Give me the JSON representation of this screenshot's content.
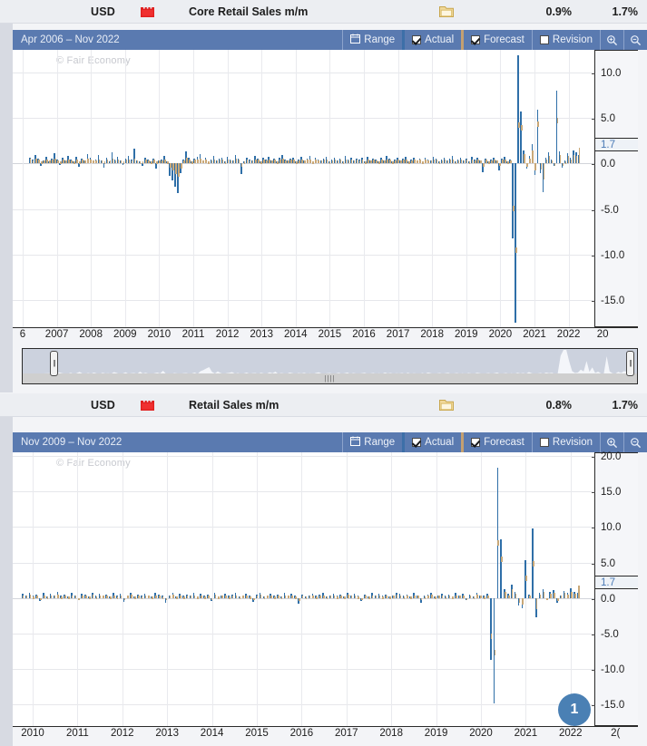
{
  "colors": {
    "actual": "#2f6fa8",
    "forecast": "#c9a878",
    "toolbar": "#5a7ab0",
    "impact_high": "#e02020",
    "badge": "#4a80b4",
    "marker_text": "#4a7ab5"
  },
  "panels": [
    {
      "event": {
        "currency": "USD",
        "impact_icon": "red-folder-icon",
        "title": "Core Retail Sales m/m",
        "detail_icon": "folder-icon",
        "actual": "0.9%",
        "forecast": "1.7%"
      },
      "toolbar": {
        "range_label": "Apr 2006 – Nov 2022",
        "range_button": "Range",
        "range_icon": "calendar-icon",
        "actual_label": "Actual",
        "actual_checked": true,
        "forecast_label": "Forecast",
        "forecast_checked": true,
        "revision_label": "Revision",
        "revision_checked": false,
        "zoom_in_icon": "zoom-in-icon",
        "zoom_out_icon": "zoom-out-icon"
      },
      "watermark": "© Fair Economy",
      "value_marker": "1.7",
      "chart_data": {
        "type": "bar",
        "title": "Core Retail Sales m/m",
        "xlabel": "",
        "ylabel": "%",
        "ylim": [
          -18.0,
          12.5
        ],
        "yticks": [
          "10.0",
          "5.0",
          "0.0",
          "-5.0",
          "-10.0",
          "-15.0"
        ],
        "ytick_values": [
          10.0,
          5.0,
          0.0,
          -5.0,
          -10.0,
          -15.0
        ],
        "grid": true,
        "legend_position": "toolbar",
        "xticks": [
          "6",
          "2007",
          "2008",
          "2009",
          "2010",
          "2011",
          "2012",
          "2013",
          "2014",
          "2015",
          "2016",
          "2017",
          "2018",
          "2019",
          "2020",
          "2021",
          "2022",
          "20"
        ],
        "marker_value": 1.7,
        "series": [
          {
            "name": "Actual",
            "color": "#2f6fa8",
            "values": [
              0.6,
              0.4,
              0.9,
              0.5,
              -0.3,
              0.3,
              0.7,
              0.2,
              0.5,
              1.1,
              0.4,
              -0.2,
              0.6,
              0.3,
              0.8,
              0.4,
              0.2,
              0.7,
              -0.4,
              0.5,
              0.3,
              1.0,
              0.6,
              0.2,
              0.4,
              0.9,
              0.3,
              -0.5,
              0.6,
              0.2,
              1.2,
              0.4,
              0.7,
              0.3,
              -0.2,
              0.5,
              0.8,
              0.4,
              1.6,
              0.3,
              0.2,
              -0.3,
              0.6,
              0.4,
              0.2,
              0.5,
              -0.6,
              0.3,
              0.4,
              0.8,
              0.2,
              -1.4,
              -1.9,
              -2.6,
              -3.2,
              -1.1,
              0.4,
              1.3,
              0.6,
              0.2,
              0.5,
              0.7,
              1.0,
              0.3,
              0.6,
              0.2,
              0.4,
              0.8,
              0.3,
              0.5,
              0.6,
              0.2,
              0.7,
              0.4,
              0.3,
              0.9,
              0.5,
              -1.2,
              0.2,
              0.6,
              0.4,
              0.3,
              0.8,
              0.5,
              0.2,
              0.6,
              0.4,
              0.7,
              0.3,
              0.5,
              0.2,
              0.6,
              0.9,
              0.4,
              0.3,
              0.5,
              0.6,
              0.2,
              0.4,
              0.7,
              0.3,
              0.5,
              0.8,
              0.2,
              0.6,
              0.4,
              0.3,
              0.5,
              0.7,
              0.2,
              0.4,
              0.6,
              0.3,
              0.5,
              0.2,
              0.8,
              0.4,
              0.6,
              0.3,
              0.5,
              0.4,
              0.6,
              0.2,
              0.7,
              0.3,
              0.5,
              0.4,
              0.2,
              0.6,
              0.3,
              0.8,
              0.5,
              0.2,
              0.4,
              0.6,
              0.3,
              0.5,
              0.7,
              0.2,
              0.4,
              0.6,
              0.3,
              0.5,
              0.2,
              0.6,
              0.4,
              0.3,
              0.7,
              0.5,
              0.2,
              0.4,
              0.6,
              0.3,
              0.5,
              0.8,
              0.2,
              0.4,
              0.6,
              0.3,
              0.5,
              0.2,
              0.7,
              0.4,
              0.6,
              0.3,
              -1.0,
              0.5,
              0.2,
              0.4,
              0.6,
              0.3,
              -0.8,
              0.5,
              0.7,
              0.2,
              0.4,
              -8.2,
              -17.5,
              11.9,
              5.7,
              1.4,
              -0.6,
              0.8,
              2.1,
              -1.3,
              5.9,
              -1.1,
              -3.1,
              0.6,
              1.2,
              0.4,
              -0.3,
              8.0,
              1.3,
              -0.5,
              0.3,
              1.1,
              0.6,
              1.4,
              1.2,
              0.9
            ]
          },
          {
            "name": "Forecast",
            "color": "#c9a878",
            "values": [
              0.5,
              0.3,
              0.5,
              0.4,
              0.2,
              0.3,
              0.4,
              0.3,
              0.4,
              0.5,
              0.3,
              0.2,
              0.4,
              0.3,
              0.4,
              0.3,
              0.2,
              0.4,
              0.2,
              0.4,
              0.3,
              0.5,
              0.4,
              0.3,
              0.3,
              0.4,
              0.3,
              0.2,
              0.4,
              0.3,
              0.5,
              0.3,
              0.4,
              0.3,
              0.2,
              0.4,
              0.4,
              0.3,
              0.5,
              0.3,
              0.2,
              0.2,
              0.4,
              0.3,
              0.2,
              0.4,
              0.2,
              0.3,
              0.3,
              0.4,
              0.2,
              -0.5,
              -0.8,
              -1.2,
              -1.5,
              -0.6,
              0.3,
              0.6,
              0.4,
              0.2,
              0.4,
              0.4,
              0.5,
              0.3,
              0.4,
              0.2,
              0.3,
              0.4,
              0.3,
              0.4,
              0.4,
              0.2,
              0.4,
              0.3,
              0.3,
              0.5,
              0.4,
              -0.4,
              0.2,
              0.4,
              0.3,
              0.3,
              0.4,
              0.4,
              0.2,
              0.4,
              0.3,
              0.4,
              0.3,
              0.4,
              0.2,
              0.4,
              0.5,
              0.3,
              0.3,
              0.4,
              0.4,
              0.2,
              0.3,
              0.4,
              0.3,
              0.4,
              0.4,
              0.2,
              0.4,
              0.3,
              0.3,
              0.4,
              0.4,
              0.2,
              0.3,
              0.4,
              0.3,
              0.4,
              0.2,
              0.4,
              0.3,
              0.4,
              0.3,
              0.4,
              0.3,
              0.4,
              0.2,
              0.4,
              0.3,
              0.4,
              0.3,
              0.2,
              0.4,
              0.3,
              0.4,
              0.4,
              0.2,
              0.3,
              0.4,
              0.3,
              0.4,
              0.4,
              0.2,
              0.3,
              0.4,
              0.3,
              0.4,
              0.2,
              0.4,
              0.3,
              0.3,
              0.4,
              0.4,
              0.2,
              0.3,
              0.4,
              0.3,
              0.4,
              0.4,
              0.2,
              0.3,
              0.4,
              0.3,
              0.4,
              0.2,
              0.4,
              0.3,
              0.4,
              0.3,
              -0.4,
              0.4,
              0.2,
              0.3,
              0.4,
              0.3,
              -0.3,
              0.4,
              0.4,
              0.2,
              0.3,
              -5.2,
              -9.8,
              4.5,
              4.2,
              1.0,
              -0.4,
              0.5,
              1.4,
              -0.8,
              4.6,
              -0.7,
              -1.8,
              0.4,
              0.8,
              0.3,
              -0.2,
              5.0,
              0.9,
              -0.3,
              0.2,
              0.8,
              0.4,
              0.9,
              0.8,
              1.7
            ]
          }
        ]
      },
      "range_selector": {
        "start_handle": "range-start-handle",
        "end_handle": "range-end-handle",
        "grip": "range-grip"
      }
    },
    {
      "event": {
        "currency": "USD",
        "impact_icon": "red-folder-icon",
        "title": "Retail Sales m/m",
        "detail_icon": "folder-icon",
        "actual": "0.8%",
        "forecast": "1.7%"
      },
      "toolbar": {
        "range_label": "Nov 2009 – Nov 2022",
        "range_button": "Range",
        "range_icon": "calendar-icon",
        "actual_label": "Actual",
        "actual_checked": true,
        "forecast_label": "Forecast",
        "forecast_checked": true,
        "revision_label": "Revision",
        "revision_checked": false,
        "zoom_in_icon": "zoom-in-icon",
        "zoom_out_icon": "zoom-out-icon"
      },
      "watermark": "© Fair Economy",
      "value_marker": "1.7",
      "badge": "1",
      "chart_data": {
        "type": "bar",
        "title": "Retail Sales m/m",
        "xlabel": "",
        "ylabel": "%",
        "ylim": [
          -18.0,
          20.5
        ],
        "yticks": [
          "20.0",
          "15.0",
          "10.0",
          "5.0",
          "0.0",
          "-5.0",
          "-10.0",
          "-15.0"
        ],
        "ytick_values": [
          20.0,
          15.0,
          10.0,
          5.0,
          0.0,
          -5.0,
          -10.0,
          -15.0
        ],
        "grid": true,
        "legend_position": "toolbar",
        "xticks": [
          "2010",
          "2011",
          "2012",
          "2013",
          "2014",
          "2015",
          "2016",
          "2017",
          "2018",
          "2019",
          "2020",
          "2021",
          "2022",
          "2("
        ],
        "marker_value": 1.7,
        "series": [
          {
            "name": "Actual",
            "color": "#2f6fa8",
            "values": [
              0.6,
              0.4,
              0.8,
              0.3,
              0.5,
              -0.4,
              0.7,
              0.2,
              0.6,
              0.4,
              0.9,
              0.3,
              0.5,
              0.2,
              0.7,
              0.4,
              -0.3,
              0.6,
              0.5,
              0.2,
              0.8,
              0.3,
              0.6,
              0.4,
              0.5,
              0.2,
              0.7,
              0.3,
              0.6,
              -0.5,
              0.4,
              0.8,
              0.2,
              0.5,
              0.3,
              0.6,
              0.4,
              0.2,
              0.7,
              0.5,
              0.3,
              -0.6,
              0.4,
              0.8,
              0.2,
              0.6,
              0.3,
              0.5,
              0.4,
              0.7,
              0.2,
              0.6,
              0.3,
              0.5,
              -0.4,
              0.8,
              0.2,
              0.4,
              0.6,
              0.3,
              0.5,
              0.7,
              0.2,
              0.4,
              0.6,
              0.3,
              -0.5,
              0.5,
              0.8,
              0.2,
              0.4,
              0.6,
              0.3,
              0.5,
              0.2,
              0.7,
              0.4,
              0.6,
              0.3,
              -0.8,
              0.5,
              0.2,
              0.4,
              0.6,
              0.3,
              0.5,
              0.7,
              0.2,
              0.4,
              0.6,
              0.3,
              0.5,
              0.2,
              0.8,
              0.4,
              0.6,
              0.3,
              -0.4,
              0.5,
              0.2,
              0.7,
              0.4,
              0.6,
              0.3,
              0.5,
              0.2,
              0.4,
              0.8,
              0.6,
              0.3,
              0.5,
              0.2,
              0.7,
              0.4,
              -0.6,
              0.3,
              0.5,
              0.8,
              0.2,
              0.4,
              0.6,
              0.3,
              0.5,
              0.2,
              0.7,
              0.4,
              0.6,
              -0.3,
              0.5,
              0.2,
              0.8,
              0.4,
              0.3,
              0.6,
              -8.7,
              -14.8,
              18.3,
              8.2,
              1.2,
              0.6,
              1.9,
              0.9,
              -1.1,
              -1.4,
              5.3,
              0.5,
              9.8,
              -2.7,
              0.7,
              1.3,
              -0.3,
              0.9,
              1.1,
              -0.6,
              0.4,
              1.0,
              0.8,
              1.4,
              0.9,
              0.8
            ]
          },
          {
            "name": "Forecast",
            "color": "#c9a878",
            "values": [
              0.4,
              0.3,
              0.5,
              0.2,
              0.4,
              -0.2,
              0.4,
              0.2,
              0.4,
              0.3,
              0.5,
              0.2,
              0.4,
              0.2,
              0.4,
              0.3,
              -0.2,
              0.4,
              0.4,
              0.2,
              0.5,
              0.2,
              0.4,
              0.3,
              0.4,
              0.2,
              0.4,
              0.2,
              0.4,
              -0.3,
              0.3,
              0.5,
              0.2,
              0.4,
              0.2,
              0.4,
              0.3,
              0.2,
              0.4,
              0.4,
              0.2,
              -0.3,
              0.3,
              0.5,
              0.2,
              0.4,
              0.2,
              0.4,
              0.3,
              0.4,
              0.2,
              0.4,
              0.2,
              0.4,
              -0.2,
              0.5,
              0.2,
              0.3,
              0.4,
              0.2,
              0.4,
              0.4,
              0.2,
              0.3,
              0.4,
              0.2,
              -0.3,
              0.4,
              0.5,
              0.2,
              0.3,
              0.4,
              0.2,
              0.4,
              0.2,
              0.4,
              0.3,
              0.4,
              0.2,
              -0.4,
              0.4,
              0.2,
              0.3,
              0.4,
              0.2,
              0.4,
              0.4,
              0.2,
              0.3,
              0.4,
              0.2,
              0.4,
              0.2,
              0.5,
              0.3,
              0.4,
              0.2,
              -0.2,
              0.4,
              0.2,
              0.4,
              0.3,
              0.4,
              0.2,
              0.4,
              0.2,
              0.3,
              0.5,
              0.4,
              0.2,
              0.4,
              0.2,
              0.4,
              0.3,
              -0.3,
              0.2,
              0.4,
              0.5,
              0.2,
              0.3,
              0.4,
              0.2,
              0.4,
              0.2,
              0.4,
              0.3,
              0.4,
              -0.2,
              0.4,
              0.2,
              0.5,
              0.3,
              0.2,
              0.4,
              -5.8,
              -8.0,
              8.1,
              5.9,
              0.9,
              0.4,
              1.2,
              0.6,
              -0.7,
              -0.9,
              3.1,
              0.3,
              5.2,
              -1.6,
              0.5,
              0.9,
              -0.2,
              0.6,
              0.8,
              -0.4,
              0.3,
              0.7,
              0.5,
              0.9,
              0.6,
              1.7
            ]
          }
        ]
      }
    }
  ]
}
